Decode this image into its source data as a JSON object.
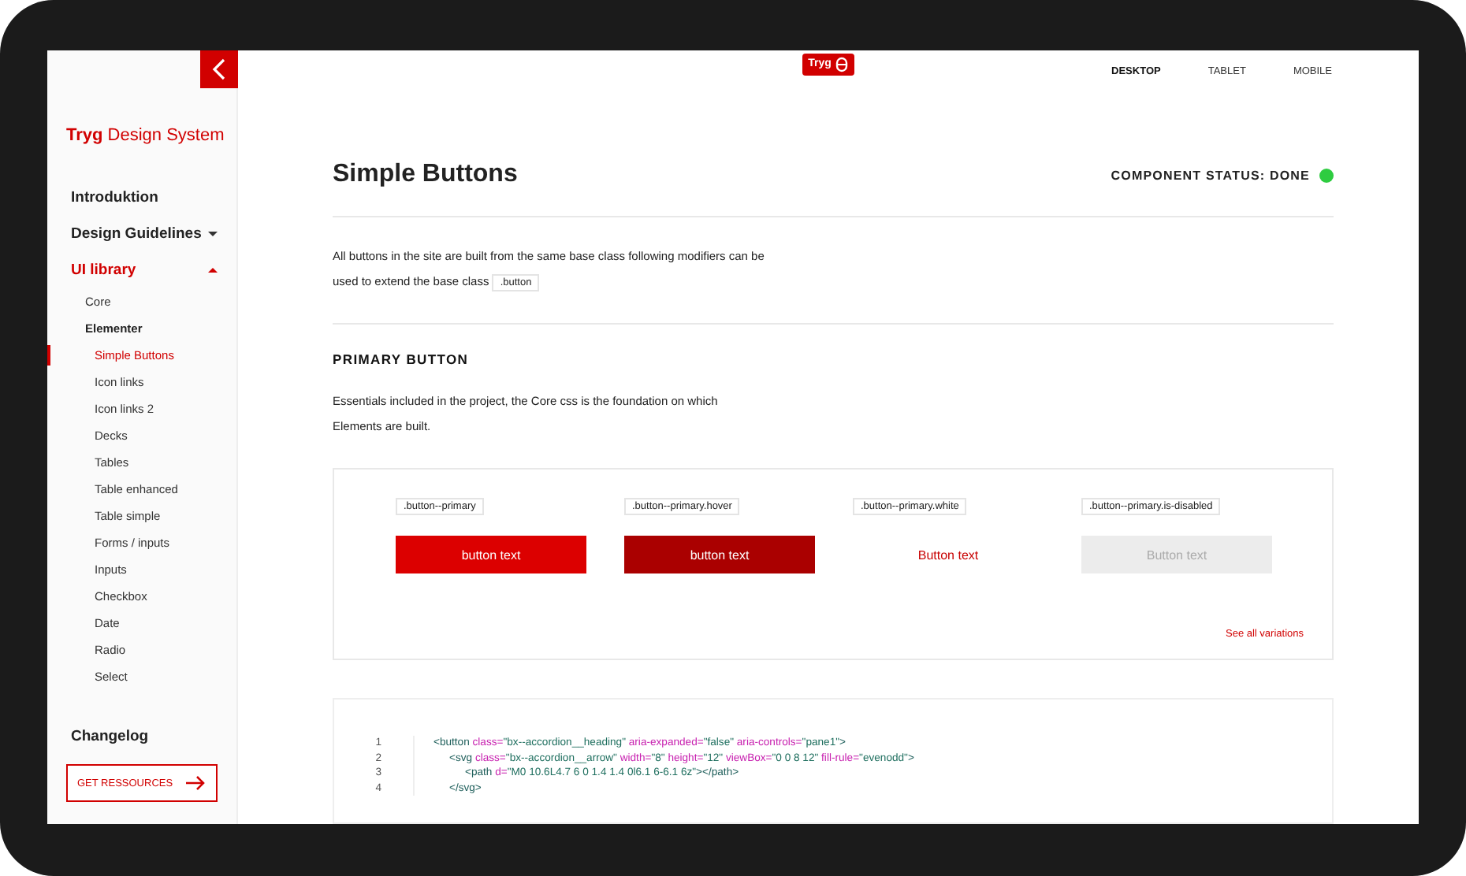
{
  "sidebar": {
    "logo": {
      "brand": "Tryg",
      "product": "Design System"
    },
    "items": [
      {
        "label": "Introduktion",
        "selected": false
      },
      {
        "label": "Design Guidelines",
        "expanded": false,
        "selected": false
      },
      {
        "label": "UI library",
        "expanded": true,
        "selected": true,
        "children": [
          {
            "label": "Core",
            "selected": false
          },
          {
            "label": "Elementer",
            "selected": false,
            "children": [
              {
                "label": "Simple Buttons",
                "selected": true
              },
              {
                "label": "Icon links",
                "selected": false
              },
              {
                "label": "Icon links 2",
                "selected": false
              },
              {
                "label": "Decks",
                "selected": false
              },
              {
                "label": "Tables",
                "selected": false
              },
              {
                "label": "Table enhanced",
                "selected": false
              },
              {
                "label": "Table simple",
                "selected": false
              },
              {
                "label": "Forms / inputs",
                "selected": false
              },
              {
                "label": "Inputs",
                "selected": false
              },
              {
                "label": "Checkbox",
                "selected": false
              },
              {
                "label": "Date",
                "selected": false
              },
              {
                "label": "Radio",
                "selected": false
              },
              {
                "label": "Select",
                "selected": false
              }
            ]
          }
        ]
      },
      {
        "label": "Changelog",
        "selected": false
      }
    ],
    "resources_button": "GET RESSOURCES"
  },
  "header": {
    "logo": "Tryg",
    "tabs": [
      {
        "label": "DESKTOP",
        "selected": true
      },
      {
        "label": "TABLET",
        "selected": false
      },
      {
        "label": "MOBILE",
        "selected": false
      }
    ]
  },
  "page": {
    "title": "Simple Buttons",
    "status": {
      "label": "COMPONENT STATUS: DONE",
      "color": "#2ecc40"
    },
    "intro": "All buttons in the site are built from the same base class following modifiers can be used to extend the base class",
    "intro_code": ".button",
    "section_title": "PRIMARY BUTTON",
    "section_text": "Essentials included in the project, the Core css is the foundation on which Elements are built.",
    "examples": [
      {
        "kind": "primary",
        "class_name": ".button--primary",
        "label": "button text"
      },
      {
        "kind": "hover",
        "class_name": ".button--primary.hover",
        "label": "button text"
      },
      {
        "kind": "white",
        "class_name": ".button--primary.white",
        "label": "Button text"
      },
      {
        "kind": "disabled",
        "class_name": ".button--primary.is-disabled",
        "label": "Button text"
      }
    ],
    "see_all": "See all variations",
    "code_lines": [
      {
        "number": "1",
        "tokens": [
          {
            "kind": "tag",
            "text": "<button "
          },
          {
            "kind": "attr",
            "text": "class="
          },
          {
            "kind": "str",
            "text": "\"bx--accordion__heading\" "
          },
          {
            "kind": "attr",
            "text": "aria-expanded="
          },
          {
            "kind": "str",
            "text": "\"false\" "
          },
          {
            "kind": "attr",
            "text": "aria-controls="
          },
          {
            "kind": "str",
            "text": "\"pane1\""
          },
          {
            "kind": "tag",
            "text": ">"
          }
        ],
        "children": [
          {
            "number": "2",
            "tokens": [
              {
                "kind": "tag",
                "text": "<svg "
              },
              {
                "kind": "attr",
                "text": "class="
              },
              {
                "kind": "str",
                "text": "\"bx--accordion__arrow\" "
              },
              {
                "kind": "attr",
                "text": "width="
              },
              {
                "kind": "str",
                "text": "\"8\" "
              },
              {
                "kind": "attr",
                "text": "height="
              },
              {
                "kind": "str",
                "text": "\"12\" "
              },
              {
                "kind": "attr",
                "text": "viewBox="
              },
              {
                "kind": "str",
                "text": "\"0 0 8 12\" "
              },
              {
                "kind": "attr",
                "text": "fill-rule="
              },
              {
                "kind": "str",
                "text": "\"evenodd\""
              },
              {
                "kind": "tag",
                "text": ">"
              }
            ],
            "children": [
              {
                "number": "3",
                "tokens": [
                  {
                    "kind": "tag",
                    "text": "<path "
                  },
                  {
                    "kind": "attr",
                    "text": "d="
                  },
                  {
                    "kind": "str",
                    "text": "\"M0 10.6L4.7 6 0 1.4 1.4 0l6.1 6-6.1 6z\""
                  },
                  {
                    "kind": "tag",
                    "text": "></path>"
                  }
                ]
              }
            ]
          },
          {
            "number": "4",
            "tokens": [
              {
                "kind": "tag",
                "text": "</svg>"
              }
            ]
          }
        ]
      }
    ]
  }
}
